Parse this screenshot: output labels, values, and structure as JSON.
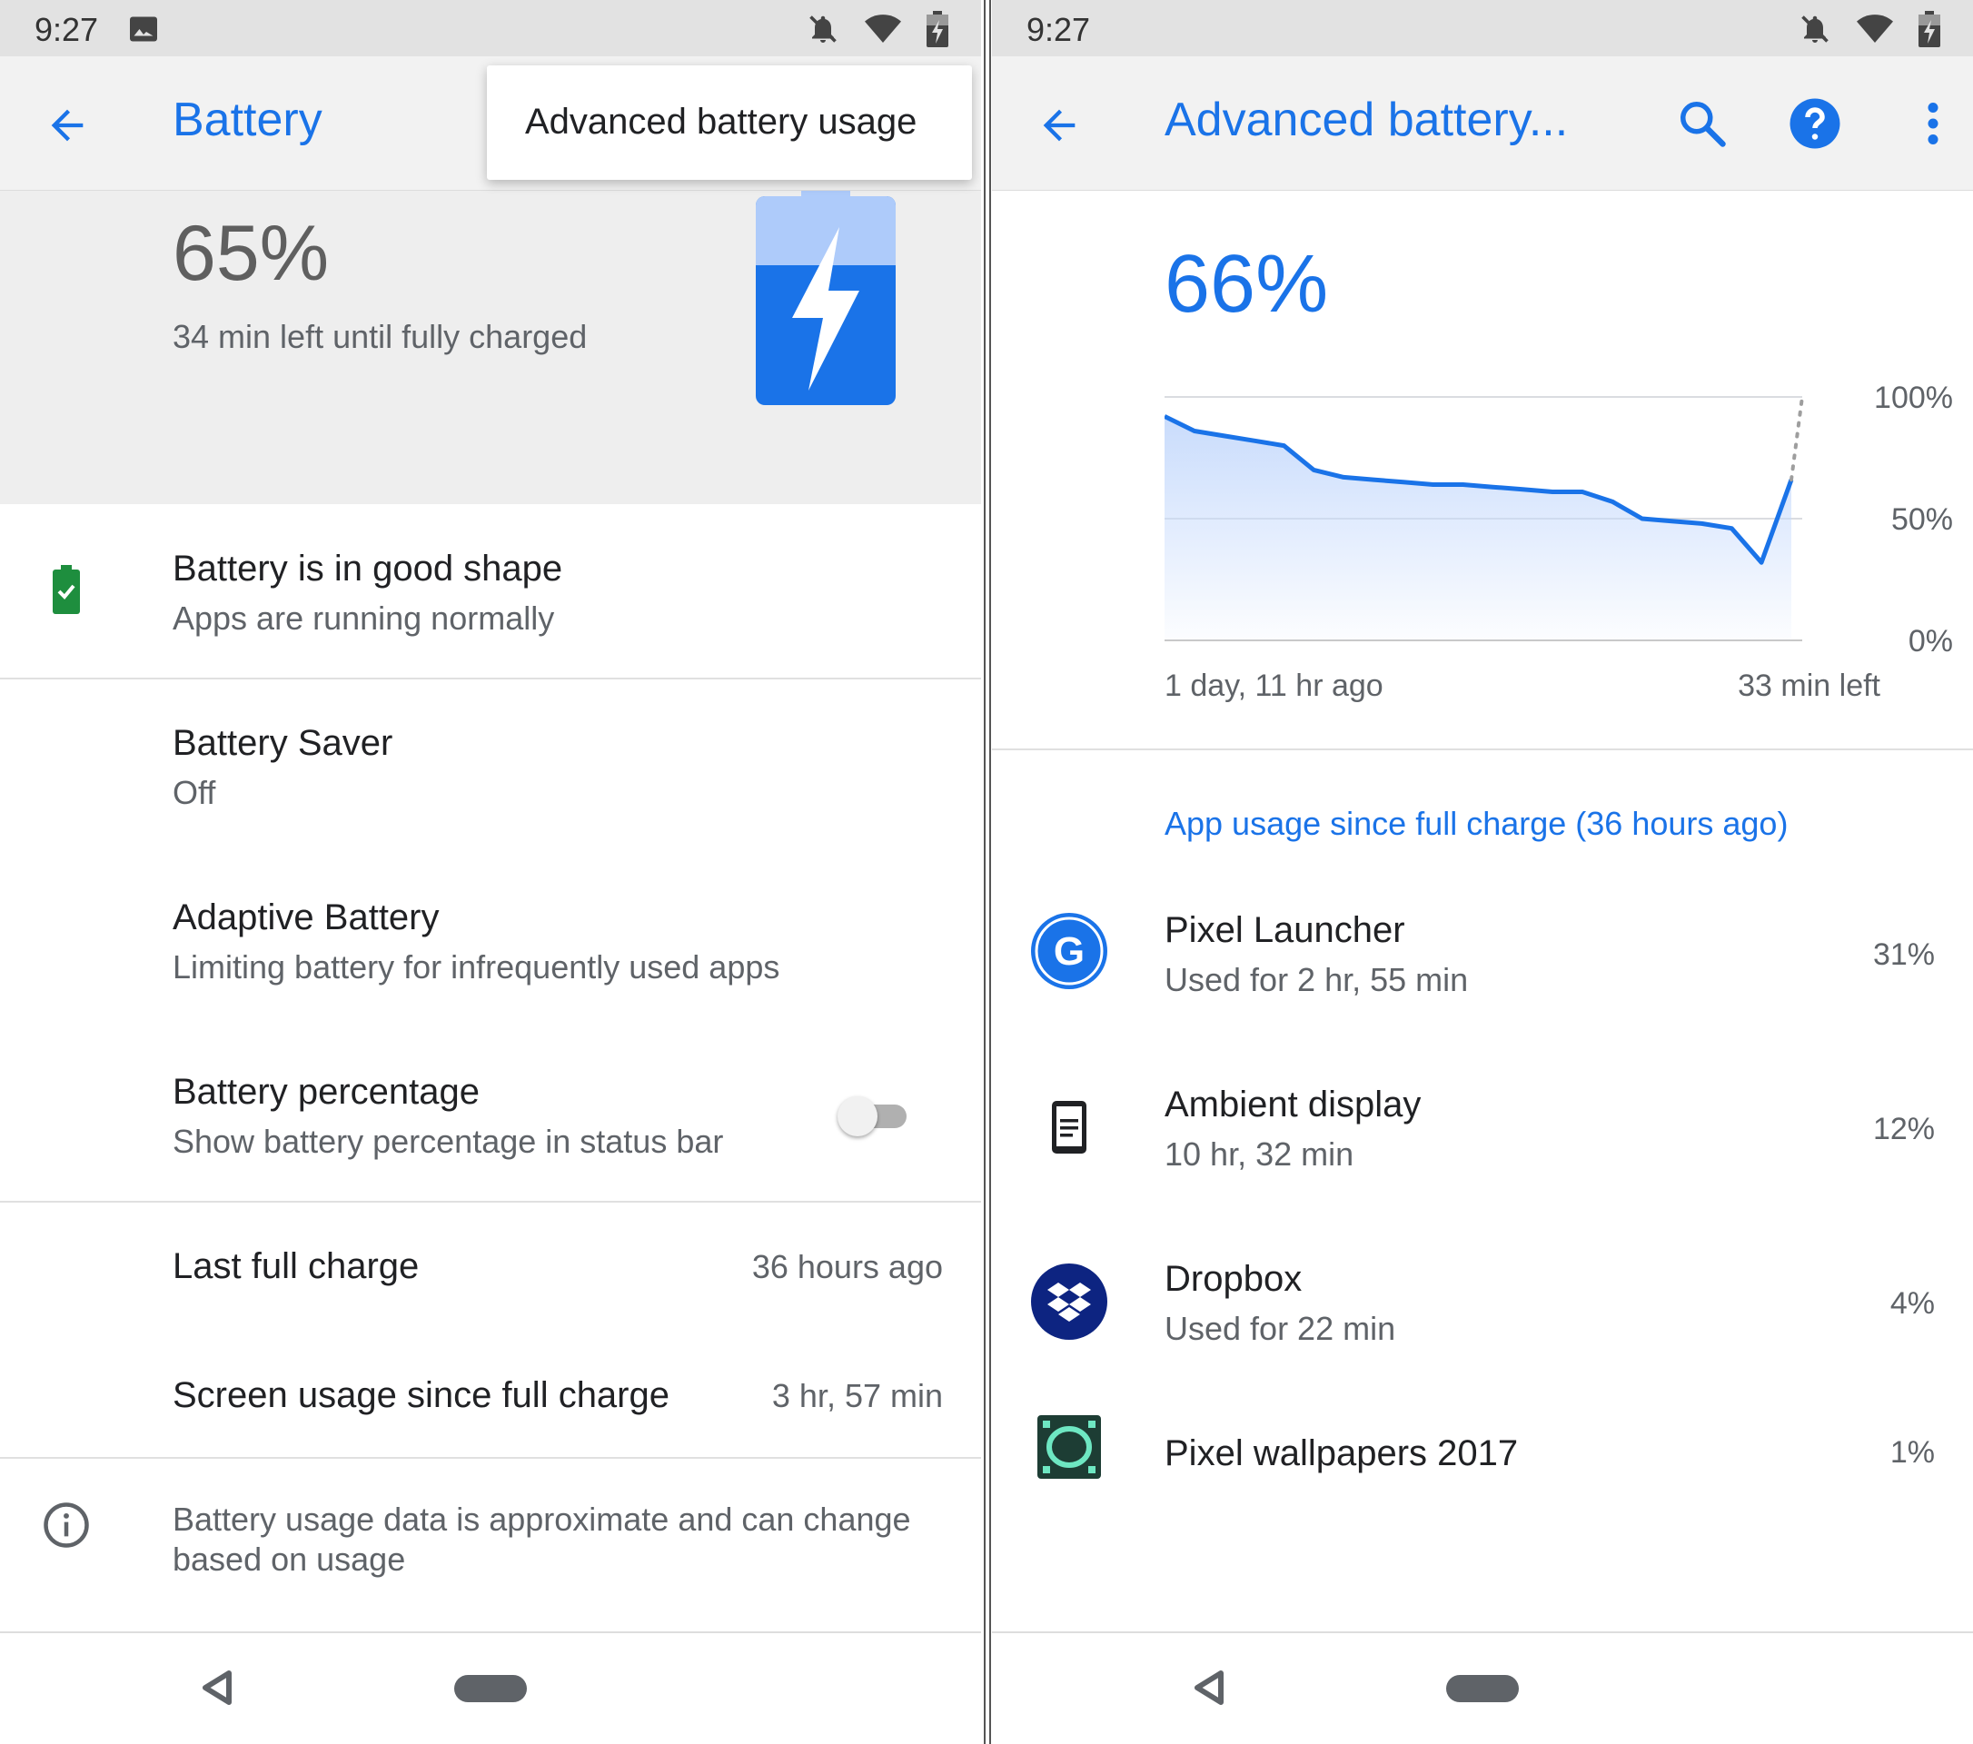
{
  "left": {
    "status": {
      "time": "9:27"
    },
    "app_bar": {
      "title": "Battery"
    },
    "popup_menu": {
      "item": "Advanced battery usage"
    },
    "hero": {
      "percent": "65%",
      "subtitle": "34 min left until fully charged"
    },
    "items": [
      {
        "title": "Battery is in good shape",
        "subtitle": "Apps are running normally"
      },
      {
        "title": "Battery Saver",
        "subtitle": "Off"
      },
      {
        "title": "Adaptive Battery",
        "subtitle": "Limiting battery for infrequently used apps"
      },
      {
        "title": "Battery percentage",
        "subtitle": "Show battery percentage in status bar",
        "toggle_on": false
      },
      {
        "title": "Last full charge",
        "value": "36 hours ago"
      },
      {
        "title": "Screen usage since full charge",
        "value": "3 hr, 57 min"
      }
    ],
    "info": {
      "line1": "Battery usage data is approximate and can change",
      "line2": "based on usage"
    }
  },
  "right": {
    "status": {
      "time": "9:27"
    },
    "app_bar": {
      "title": "Advanced battery..."
    },
    "hero": {
      "percent": "66%"
    },
    "chart_data": {
      "type": "area",
      "y_ticks": [
        "100%",
        "50%",
        "0%"
      ],
      "ylim": [
        0,
        100
      ],
      "x_start_label": "1 day, 11 hr ago",
      "x_end_label": "33 min left",
      "series": [
        {
          "values": [
            92,
            86,
            84,
            82,
            80,
            70,
            67,
            66,
            65,
            64,
            64,
            63,
            62,
            61,
            61,
            57,
            50,
            49,
            48,
            46,
            32,
            66
          ]
        }
      ],
      "projection": [
        66,
        100
      ]
    },
    "section_title": "App usage since full charge (36 hours ago)",
    "apps": [
      {
        "name": "Pixel Launcher",
        "detail": "Used for 2 hr, 55 min",
        "percent": "31%",
        "icon": "google-g-icon"
      },
      {
        "name": "Ambient display",
        "detail": "10 hr, 32 min",
        "percent": "12%",
        "icon": "phone-screen-icon"
      },
      {
        "name": "Dropbox",
        "detail": "Used for 22 min",
        "percent": "4%",
        "icon": "dropbox-icon"
      },
      {
        "name": "Pixel wallpapers 2017",
        "detail": "",
        "percent": "1%",
        "icon": "wallpaper-icon"
      }
    ]
  },
  "colors": {
    "accent": "#1a73e8",
    "good": "#1e8e3e"
  }
}
